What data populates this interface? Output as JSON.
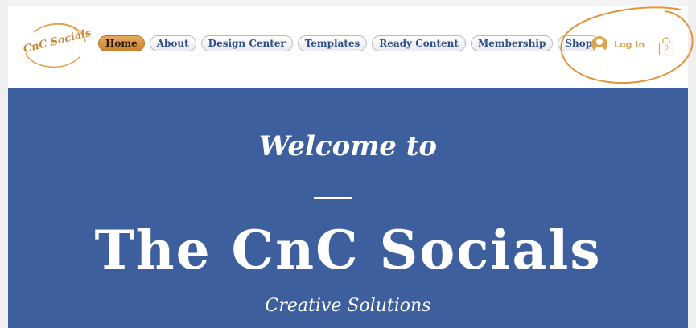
{
  "logo": {
    "text": "CnC Socials"
  },
  "nav": {
    "items": [
      {
        "label": "Home",
        "active": true
      },
      {
        "label": "About",
        "active": false
      },
      {
        "label": "Design Center",
        "active": false
      },
      {
        "label": "Templates",
        "active": false
      },
      {
        "label": "Ready Content",
        "active": false
      },
      {
        "label": "Membership",
        "active": false
      },
      {
        "label": "Shop",
        "active": false
      }
    ]
  },
  "account": {
    "login_label": "Log In",
    "avatar_icon": "user-avatar-icon"
  },
  "cart": {
    "count": "0",
    "icon": "shopping-bag-icon"
  },
  "hero": {
    "welcome": "Welcome to",
    "title": "The CnC Socials",
    "subtitle": "Creative Solutions"
  },
  "colors": {
    "brand_gold": "#e0a24a",
    "nav_text": "#2e4f8c",
    "hero_bg": "#3d5f9e",
    "annotation_circle": "#e0953a"
  }
}
